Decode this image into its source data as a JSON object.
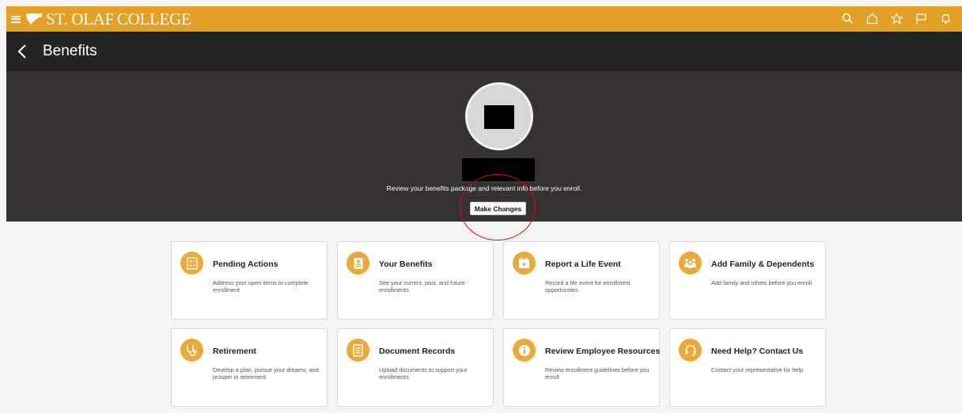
{
  "header": {
    "logo_text": "ST. OLAF",
    "logo_college": "COLLEGE",
    "icons": [
      "search-icon",
      "home-icon",
      "star-icon",
      "flag-icon",
      "bell-icon"
    ],
    "accent_color": "#e2a126"
  },
  "titlebar": {
    "title": "Benefits"
  },
  "hero": {
    "description": "Review your benefits package and relevant info before you enroll.",
    "button_label": "Make Changes"
  },
  "cards": [
    {
      "title": "Pending Actions",
      "desc": "Address your open items to complete enrollment",
      "icon": "checklist-icon"
    },
    {
      "title": "Your Benefits",
      "desc": "See your current, past, and future enrollments",
      "icon": "badge-icon"
    },
    {
      "title": "Report a Life Event",
      "desc": "Record a life event for enrollment opportunities",
      "icon": "calendar-star-icon"
    },
    {
      "title": "Add Family & Dependents",
      "desc": "Add family and others before you enroll",
      "icon": "family-icon"
    },
    {
      "title": "Retirement",
      "desc": "Develop a plan, pursue your dreams, and prosper in retirement",
      "icon": "stethoscope-icon"
    },
    {
      "title": "Document Records",
      "desc": "Upload documents to support your enrollments",
      "icon": "document-icon"
    },
    {
      "title": "Review Employee Resources",
      "desc": "Review enrollment guidelines before you enroll",
      "icon": "info-icon"
    },
    {
      "title": "Need Help? Contact Us",
      "desc": "Contact your representative for help",
      "icon": "headset-icon"
    }
  ]
}
